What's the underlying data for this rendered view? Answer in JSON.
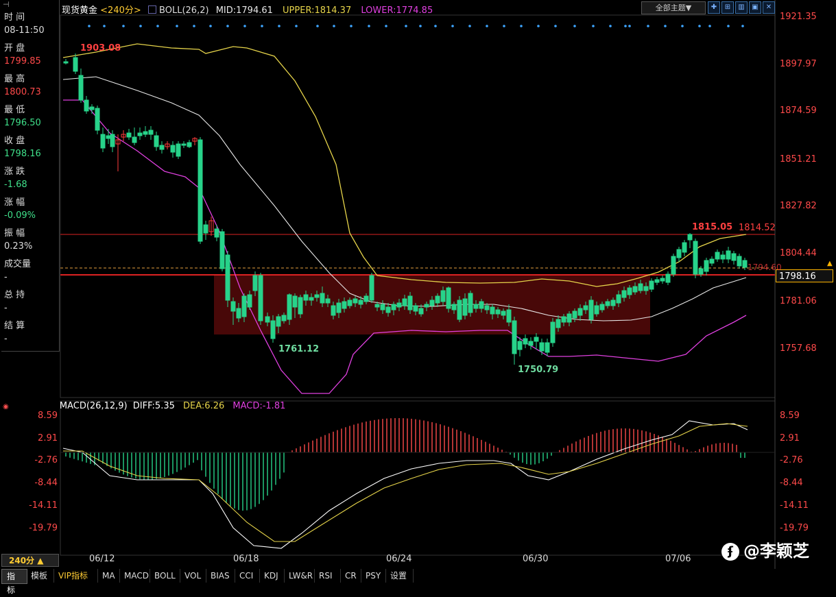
{
  "header": {
    "symbol": "现货黄金",
    "period": "<240分>",
    "indicator": "BOLL(26,2)",
    "mid": "MID:1794.61",
    "upper": "UPPER:1814.37",
    "lower": "LOWER:1774.85",
    "theme_button": "全部主题▼"
  },
  "side_panel": {
    "items": [
      {
        "label": "时 间",
        "value": "08-11:50"
      },
      {
        "label": "开 盘",
        "value": "1799.85"
      },
      {
        "label": "最 高",
        "value": "1800.73"
      },
      {
        "label": "最 低",
        "value": "1796.50"
      },
      {
        "label": "收 盘",
        "value": "1798.16"
      },
      {
        "label": "涨 跌",
        "value": "-1.68"
      },
      {
        "label": "涨 幅",
        "value": "-0.09%"
      },
      {
        "label": "振 幅",
        "value": "0.23%"
      },
      {
        "label": "成交量",
        "value": "-"
      },
      {
        "label": "总 持",
        "value": "-"
      },
      {
        "label": "结 算",
        "value": "-"
      }
    ]
  },
  "price_axis": [
    "1921.35",
    "1897.97",
    "1874.59",
    "1851.21",
    "1827.82",
    "1804.44",
    "1781.06",
    "1757.68"
  ],
  "current_price_tag": "1798.16",
  "annotations": {
    "high_start": "1903.08",
    "low_1": "1761.12",
    "low_2": "1750.79",
    "high_recent": "1815.05",
    "level_line": "1814.52",
    "level_2": "1794.60"
  },
  "macd": {
    "title": "MACD(26,12,9)",
    "diff": "DIFF:5.35",
    "dea": "DEA:6.26",
    "macd": "MACD:-1.81",
    "axis": [
      "8.59",
      "2.91",
      "-2.76",
      "-8.44",
      "-14.11",
      "-19.79"
    ]
  },
  "date_axis": [
    "06/12",
    "06/18",
    "06/24",
    "06/30",
    "07/06"
  ],
  "period_button": "240分 ▲",
  "watermark": "@李颖芝",
  "bottom_tabs": [
    "指标",
    "模板",
    "VIP指标",
    "MA",
    "MACD",
    "BOLL",
    "VOL",
    "BIAS",
    "CCI",
    "KDJ",
    "LW&R",
    "RSI",
    "CR",
    "PSY",
    "设置"
  ],
  "colors": {
    "up": "#ff3b3b",
    "down": "#27d38a",
    "upper_band": "#e6d44a",
    "mid_band": "#e8e8e8",
    "lower_band": "#e040e0",
    "level": "#ff2a2a"
  }
}
